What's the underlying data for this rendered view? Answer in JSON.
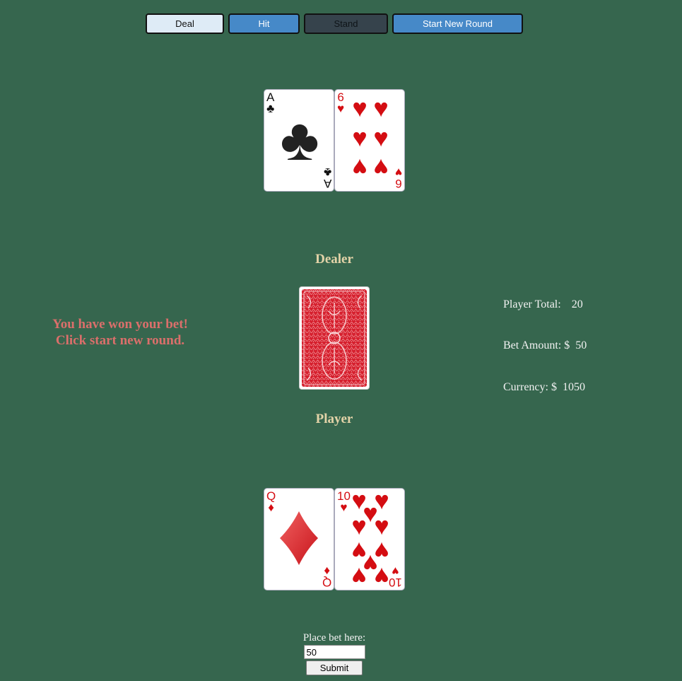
{
  "controls": {
    "deal_label": "Deal",
    "hit_label": "Hit",
    "stand_label": "Stand",
    "new_round_label": "Start New Round"
  },
  "dealer": {
    "label": "Dealer",
    "cards": [
      {
        "rank": "A",
        "suit": "♣"
      },
      {
        "rank": "6",
        "suit": "♥"
      }
    ]
  },
  "player": {
    "label": "Player",
    "cards": [
      {
        "rank": "Q",
        "suit": "♦"
      },
      {
        "rank": "10",
        "suit": "♥"
      }
    ]
  },
  "message": "You have won your bet! Click start new round.",
  "stats": {
    "player_total_label": "Player Total:",
    "player_total": "20",
    "bet_amount_label": "Bet Amount: $",
    "bet_amount": "50",
    "currency_label": "Currency: $",
    "currency": "1050"
  },
  "bet": {
    "label": "Place bet here:",
    "value": "50",
    "submit_label": "Submit"
  },
  "colors": {
    "table": "#36664e",
    "card_red": "#d40d12",
    "card_back": "#d6202e",
    "message": "#db6f6b"
  }
}
